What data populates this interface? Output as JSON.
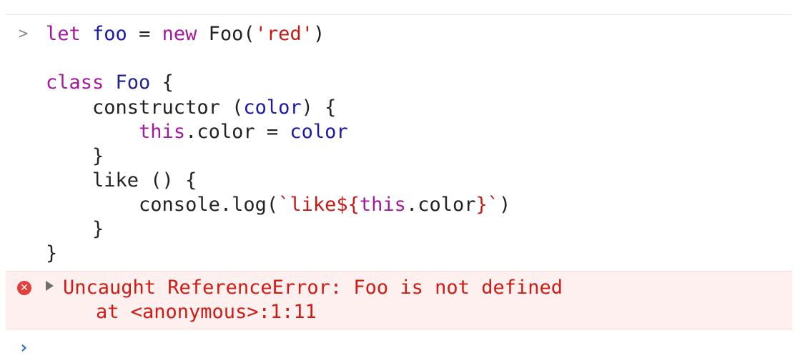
{
  "console": {
    "entry": {
      "prompt_symbol": ">",
      "lines": [
        [
          {
            "text": "let",
            "kind": "keyword"
          },
          {
            "text": " ",
            "kind": "plain"
          },
          {
            "text": "foo",
            "kind": "var"
          },
          {
            "text": " = ",
            "kind": "plain"
          },
          {
            "text": "new",
            "kind": "keyword"
          },
          {
            "text": " Foo(",
            "kind": "plain"
          },
          {
            "text": "'red'",
            "kind": "string"
          },
          {
            "text": ")",
            "kind": "plain"
          }
        ],
        [],
        [
          {
            "text": "class",
            "kind": "keyword"
          },
          {
            "text": " ",
            "kind": "plain"
          },
          {
            "text": "Foo",
            "kind": "class"
          },
          {
            "text": " {",
            "kind": "plain"
          }
        ],
        [
          {
            "text": "    constructor (",
            "kind": "plain"
          },
          {
            "text": "color",
            "kind": "var"
          },
          {
            "text": ") {",
            "kind": "plain"
          }
        ],
        [
          {
            "text": "        ",
            "kind": "plain"
          },
          {
            "text": "this",
            "kind": "keyword"
          },
          {
            "text": ".color = ",
            "kind": "plain"
          },
          {
            "text": "color",
            "kind": "var"
          }
        ],
        [
          {
            "text": "    }",
            "kind": "plain"
          }
        ],
        [
          {
            "text": "    like () {",
            "kind": "plain"
          }
        ],
        [
          {
            "text": "        console.log(",
            "kind": "plain"
          },
          {
            "text": "`like${",
            "kind": "string"
          },
          {
            "text": "this",
            "kind": "keyword"
          },
          {
            "text": ".color",
            "kind": "plain"
          },
          {
            "text": "}`",
            "kind": "string"
          },
          {
            "text": ")",
            "kind": "plain"
          }
        ],
        [
          {
            "text": "    }",
            "kind": "plain"
          }
        ],
        [
          {
            "text": "}",
            "kind": "plain"
          }
        ]
      ]
    },
    "error": {
      "icon": "error-circle-icon",
      "icon_glyph": "✕",
      "message": "Uncaught ReferenceError: Foo is not defined",
      "stack": "at <anonymous>:1:11"
    },
    "input_prompt": {
      "symbol": "›",
      "icon": "chevron-right-icon"
    }
  },
  "colors": {
    "keyword": "#a41a9c",
    "string": "#c41a16",
    "class": "#22228a",
    "var": "#1a1aa6",
    "error_text": "#d11a12",
    "error_background": "#fff0f0",
    "prompt_accent": "#2b6bd6"
  }
}
